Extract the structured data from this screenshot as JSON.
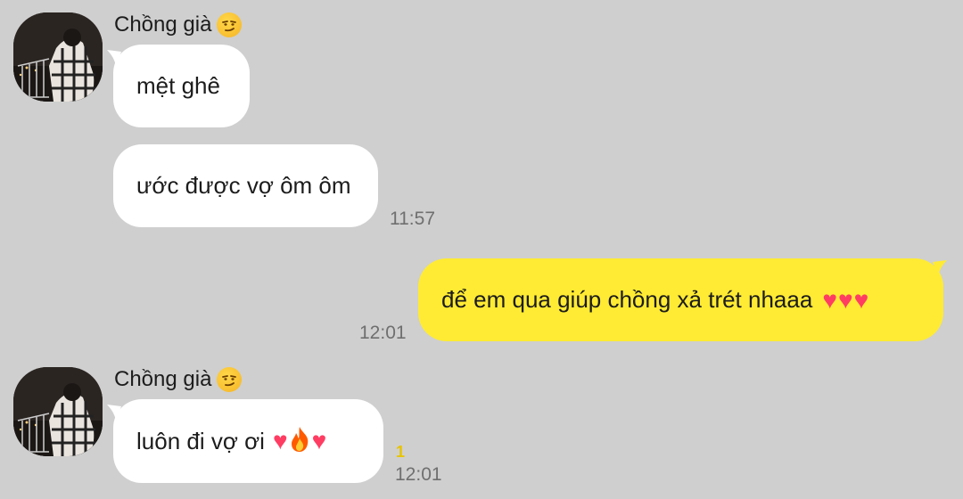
{
  "messages": [
    {
      "sender_name": "Chồng già",
      "sender_emoji": "smirk-face-emoji",
      "bubbles": [
        {
          "text": "mệt ghê"
        },
        {
          "text": "ước được vợ ôm ôm",
          "time": "11:57"
        }
      ]
    },
    {
      "mine": true,
      "bubbles": [
        {
          "text": "để em qua giúp chồng xả trét nhaaa",
          "emoji": [
            "heart-emoji",
            "heart-emoji",
            "heart-emoji"
          ],
          "time": "12:01"
        }
      ]
    },
    {
      "sender_name": "Chồng già",
      "sender_emoji": "smirk-face-emoji",
      "bubbles": [
        {
          "text": "luôn đi vợ ơi",
          "emoji": [
            "heart-emoji",
            "fire-emoji",
            "heart-emoji"
          ],
          "time": "12:01",
          "unread": "1"
        }
      ]
    }
  ],
  "colors": {
    "background": "#cfcfcf",
    "incoming_bubble": "#ffffff",
    "outgoing_bubble": "#ffeb33",
    "unread_count": "#e8c400",
    "timestamp": "#6f6f6f"
  }
}
